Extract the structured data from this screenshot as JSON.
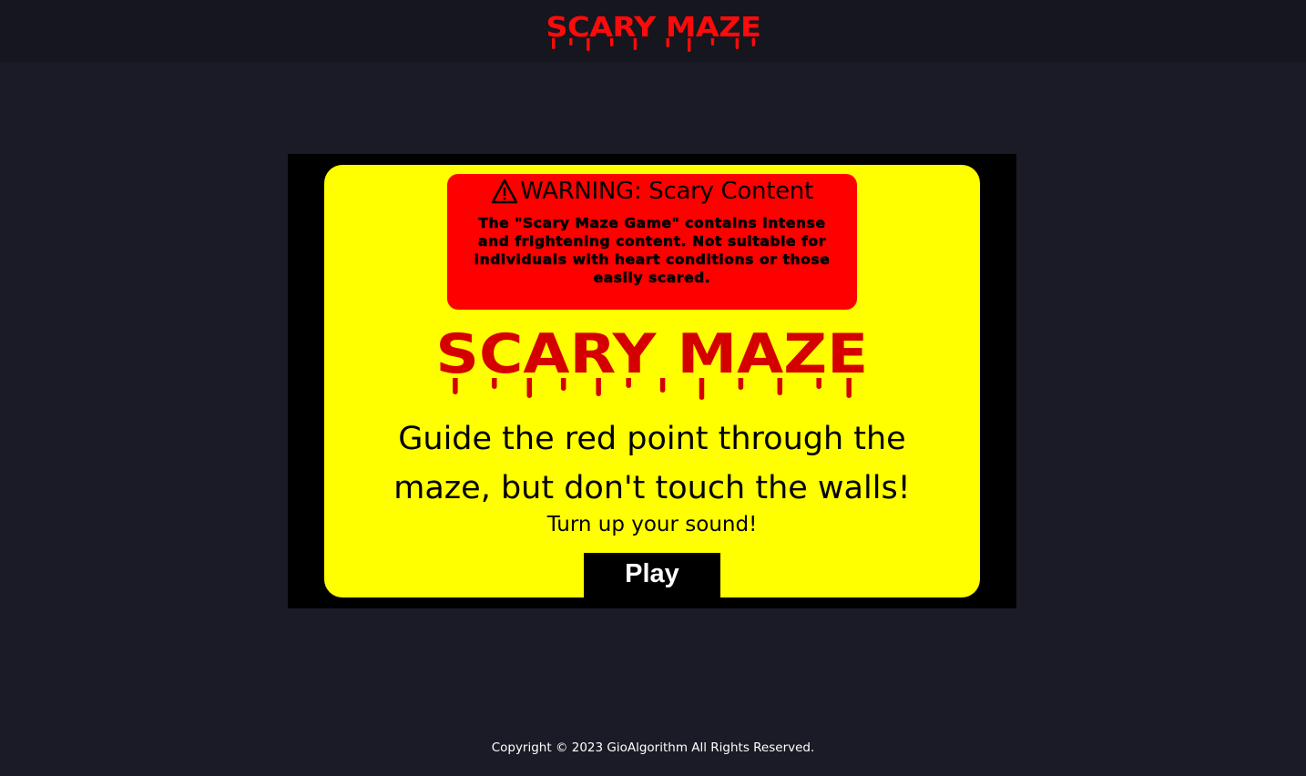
{
  "header": {
    "logo_text": "SCARY MAZE"
  },
  "warning": {
    "icon": "warning-triangle-icon",
    "title": "WARNING: Scary Content",
    "body": "The \"Scary Maze Game\" contains intense and frightening content. Not suitable for individuals with heart conditions or those easily scared."
  },
  "game": {
    "title": "SCARY MAZE",
    "instructions": "Guide the red point through the maze, but don't touch the walls!",
    "sound_hint": "Turn up your sound!",
    "play_label": "Play"
  },
  "footer": {
    "copyright": "Copyright © 2023 GioAlgorithm All Rights Reserved."
  },
  "colors": {
    "page_background": "#1a1b26",
    "header_background": "#15161e",
    "logo_red": "#ff0a0a",
    "panel_yellow": "#ffff00",
    "warning_red": "#ff0000",
    "title_red": "#d40000"
  }
}
